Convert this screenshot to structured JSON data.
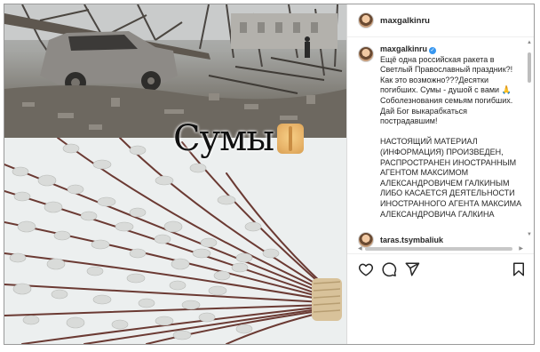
{
  "post": {
    "overlay_title": "Сумы",
    "author": {
      "username": "maxgalkinru"
    },
    "caption": {
      "username": "maxgalkinru",
      "text": "Ещё одна российская ракета в Светлый Православный праздник?! Как это возможно???Десятки погибших. Сумы - душой с вами 🙏 Соболезнования семьям погибших. Дай Бог выкарабкаться пострадавшим!\n\nНАСТОЯЩИЙ МАТЕРИАЛ (ИНФОРМАЦИЯ) ПРОИЗВЕДЕН, РАСПРОСТРАНЕН ИНОСТРАННЫМ АГЕНТОМ МАКСИМОМ АЛЕКСАНДРОВИЧЕМ ГАЛКИНЫМ ЛИБО КАСАЕТСЯ ДЕЯТЕЛЬНОСТИ ИНОСТРАННОГО АГЕНТА МАКСИМА АЛЕКСАНДРОВИЧА ГАЛКИНА"
    },
    "first_comment": {
      "username": "taras.tsymbaliuk"
    },
    "action_icons": [
      "heart-icon",
      "comment-icon",
      "share-icon",
      "bookmark-icon"
    ]
  },
  "colors": {
    "verified": "#3897f0",
    "text": "#262626",
    "border": "#dbdbdb"
  }
}
